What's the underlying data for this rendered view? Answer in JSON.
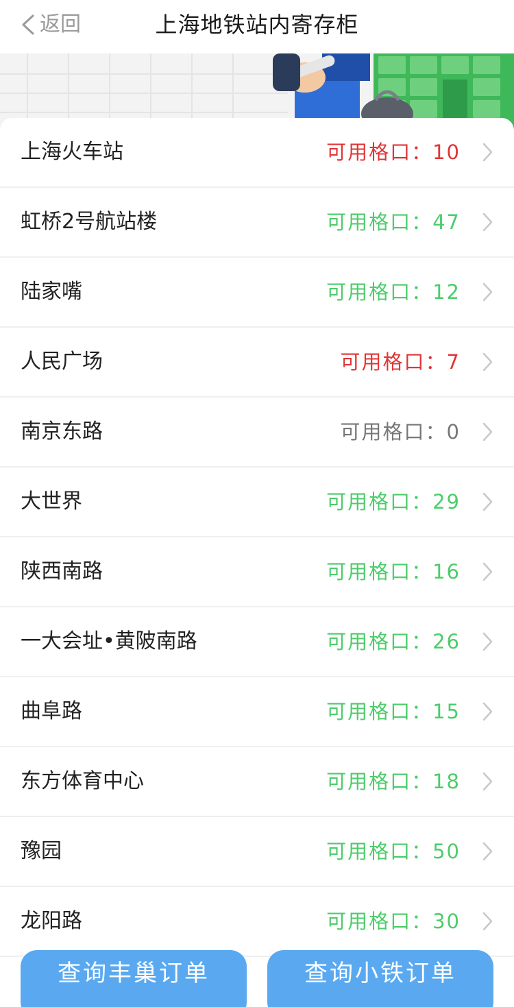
{
  "header": {
    "back_label": "返回",
    "title": "上海地铁站内寄存柜"
  },
  "colors": {
    "red": "#e03535",
    "green": "#4ccc6a",
    "gray": "#777777",
    "button": "#5aa9f0"
  },
  "stations": [
    {
      "name": "上海火车站",
      "avail": "可用格口：10",
      "status": "red"
    },
    {
      "name": "虹桥2号航站楼",
      "avail": "可用格口：47",
      "status": "green"
    },
    {
      "name": "陆家嘴",
      "avail": "可用格口：12",
      "status": "green"
    },
    {
      "name": "人民广场",
      "avail": "可用格口：7",
      "status": "red"
    },
    {
      "name": "南京东路",
      "avail": "可用格口：0",
      "status": "gray"
    },
    {
      "name": "大世界",
      "avail": "可用格口：29",
      "status": "green"
    },
    {
      "name": "陕西南路",
      "avail": "可用格口：16",
      "status": "green"
    },
    {
      "name": "一大会址•黄陂南路",
      "avail": "可用格口：26",
      "status": "green"
    },
    {
      "name": "曲阜路",
      "avail": "可用格口：15",
      "status": "green"
    },
    {
      "name": "东方体育中心",
      "avail": "可用格口：18",
      "status": "green"
    },
    {
      "name": "豫园",
      "avail": "可用格口：50",
      "status": "green"
    },
    {
      "name": "龙阳路",
      "avail": "可用格口：30",
      "status": "green"
    }
  ],
  "buttons": {
    "left": "查询丰巢订单",
    "right": "查询小铁订单"
  },
  "icons": {
    "back": "chevron-left-icon",
    "row": "chevron-right-icon"
  }
}
